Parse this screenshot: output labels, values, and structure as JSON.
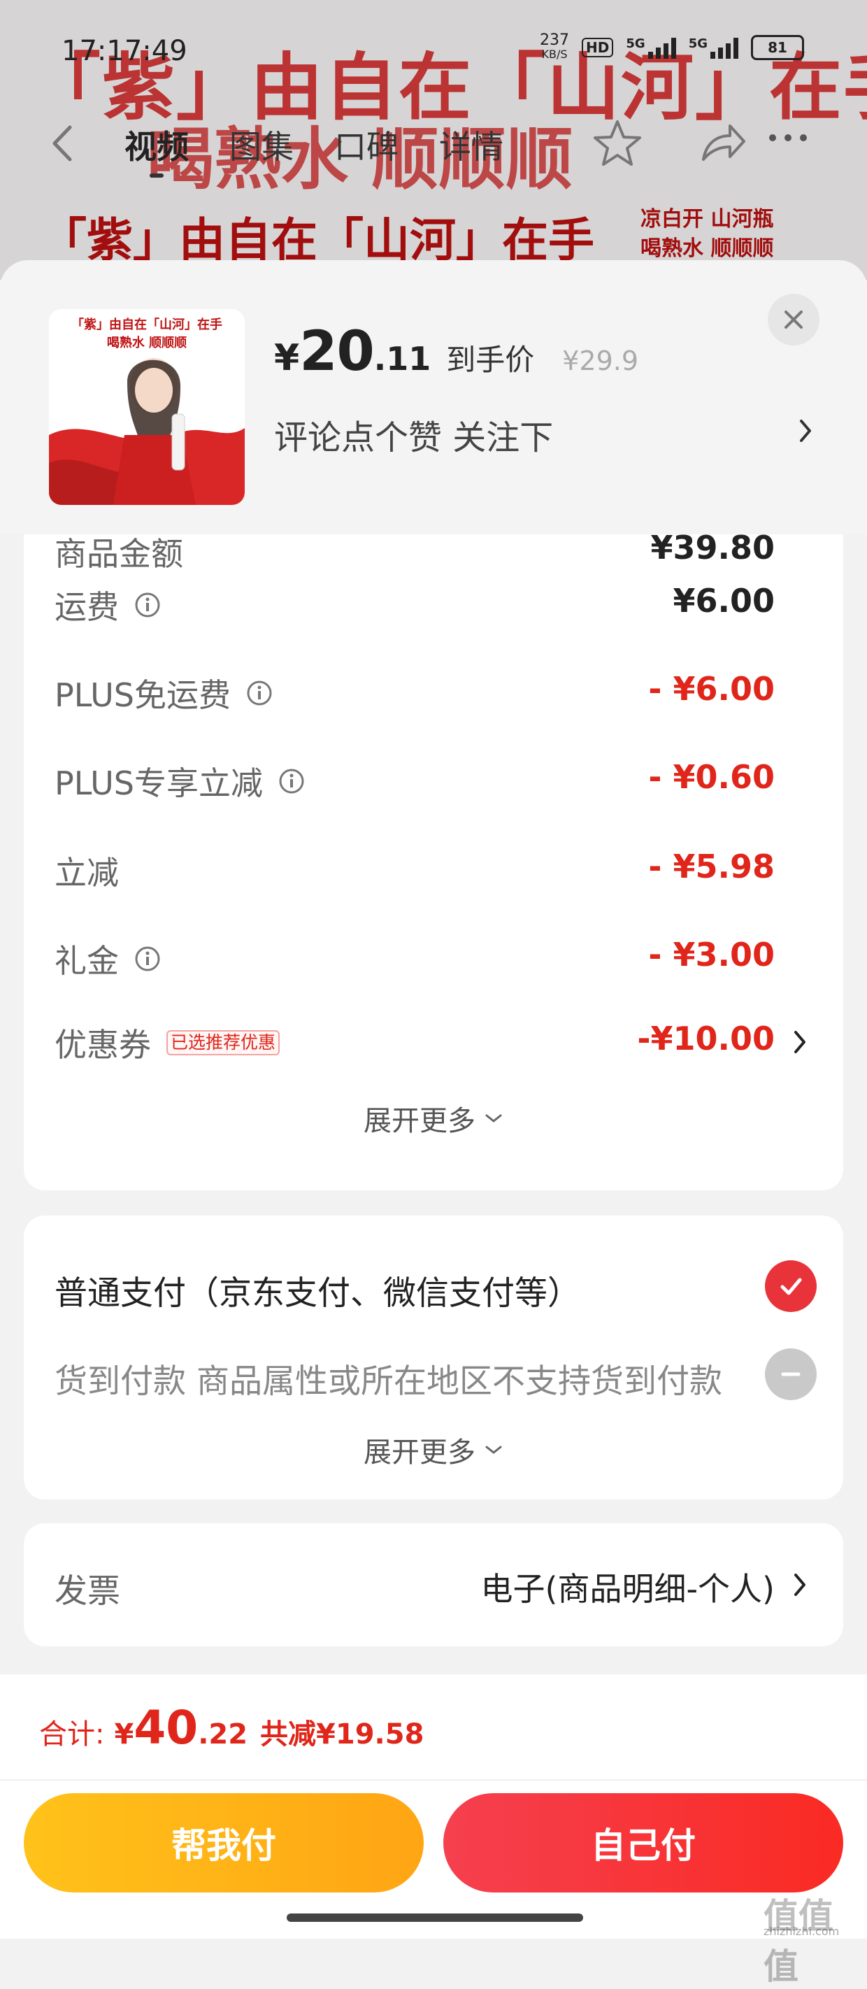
{
  "status_bar": {
    "time": "17:17:49",
    "net_speed_value": "237",
    "net_speed_unit": "KB/S",
    "hd_label": "HD",
    "signal_1_label": "5G",
    "signal_2_label": "5G",
    "battery": "81"
  },
  "background": {
    "banner_line1": "「紫」由自在「山河」在手",
    "banner_line2": "喝熟水 顺顺顺",
    "strip_main": "「紫」由自在「山河」在手",
    "strip_side_1": "凉白开 山河瓶",
    "strip_side_2": "喝熟水 顺顺顺"
  },
  "top_nav": {
    "tabs": [
      {
        "label": "视频",
        "active": true
      },
      {
        "label": "图集",
        "active": false
      },
      {
        "label": "口碑",
        "active": false
      },
      {
        "label": "详情",
        "active": false
      }
    ]
  },
  "product": {
    "thumb_line1": "「紫」由自在「山河」在手",
    "thumb_line2": "喝熟水  顺顺顺",
    "price_symbol": "¥",
    "price_int": "20",
    "price_dec": ".11",
    "price_tag": "到手价",
    "original_price": "¥29.9",
    "tagline": "评论点个赞  关注下"
  },
  "fees": {
    "partial_label": "商品金额",
    "partial_value": "¥39.80",
    "rows": [
      {
        "label": "运费",
        "value": "¥6.00",
        "info": true
      },
      {
        "label": "PLUS免运费",
        "value": "- ¥6.00",
        "info": true
      },
      {
        "label": "PLUS专享立减",
        "value": "- ¥0.60",
        "info": true
      },
      {
        "label": "立减",
        "value": "- ¥5.98",
        "info": false
      },
      {
        "label": "礼金",
        "value": "- ¥3.00",
        "info": true
      }
    ],
    "coupon_label": "优惠券",
    "coupon_badge": "已选推荐优惠",
    "coupon_value": "-¥10.00",
    "expand_label": "展开更多"
  },
  "payment": {
    "normal_label": "普通支付（京东支付、微信支付等）",
    "cod_label": "货到付款 商品属性或所在地区不支持货到付款",
    "expand_label": "展开更多"
  },
  "invoice": {
    "label": "发票",
    "value": "电子(商品明细-个人)"
  },
  "footer": {
    "total_label": "合计:",
    "total_symbol": "¥",
    "total_int": "40",
    "total_dec": ".22",
    "saved": "共减¥19.58",
    "help_pay": "帮我付",
    "self_pay": "自己付",
    "watermark": "值值值",
    "watermark_url": "zhizhizhi.com"
  },
  "colors": {
    "accent_red": "#e0261b",
    "help_button": "#ffb316",
    "self_button": "#f5373a"
  }
}
